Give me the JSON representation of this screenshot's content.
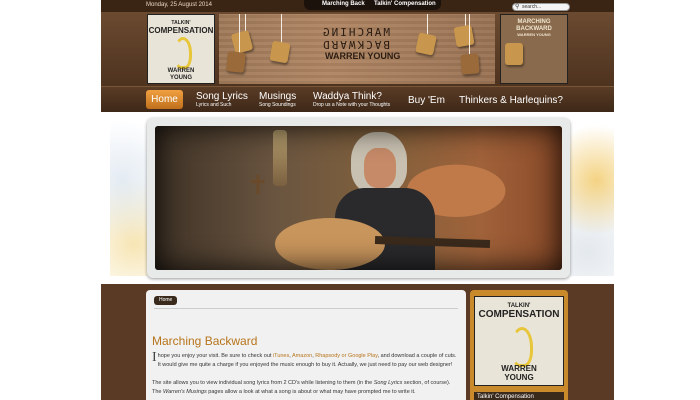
{
  "topbar": {
    "date": "Monday, 25 August 2014",
    "tabs": [
      "Marching Back",
      "Talkin' Compensation"
    ],
    "search_value": "search..."
  },
  "header": {
    "album_left": {
      "title1": "TALKIN'",
      "title2": "COMPENSATION",
      "artist1": "WARREN",
      "artist2": "YOUNG"
    },
    "banner": {
      "line1": "MARCHING",
      "line2": "BACKWARD",
      "artist": "WARREN YOUNG"
    },
    "album_right": {
      "title1": "MARCHING",
      "title2": "BACKWARD",
      "artist": "WARREN YOUNG"
    }
  },
  "nav": {
    "items": [
      {
        "label": "Home",
        "sub": ""
      },
      {
        "label": "Song Lyrics",
        "sub": "Lyrics and Such"
      },
      {
        "label": "Musings",
        "sub": "Song Soundings"
      },
      {
        "label": "Waddya Think?",
        "sub": "Drop us a Note with your Thoughts"
      },
      {
        "label": "Buy 'Em",
        "sub": ""
      },
      {
        "label": "Thinkers & Harlequins?",
        "sub": ""
      }
    ]
  },
  "breadcrumb": "Home",
  "post": {
    "title": "Marching Backward",
    "dropcap": "I",
    "p1_a": " hope you enjoy your visit.  Be sure to check out  ",
    "link_itunes": "iTunes",
    "sep1": ", ",
    "link_amazon": "Amazon",
    "sep2": ", ",
    "link_rhapsody": "Rhapsody or Google Play",
    "p1_b": ", and download a couple of cuts.  It would give me quite a charge if you enjoyed the music enough to buy it.  Actually, we just need to pay our web designer!",
    "p2_a": "The site allows you to view individual song lyrics from 2 CD's while listening to them (in the ",
    "p2_em1": "Song Lyrics",
    "p2_b": " section, of course).  The ",
    "p2_em2": "Warren's Musings",
    "p2_c": " pages allow a look at what a song is about or what may have prompted me to write it."
  },
  "sidebar": {
    "album": {
      "title1": "TALKIN'",
      "title2": "COMPENSATION",
      "artist1": "WARREN",
      "artist2": "YOUNG"
    },
    "widget_title": "Talkin' Compensation"
  },
  "colors": {
    "brown_dark": "#3a2414",
    "brown": "#5a3a24",
    "accent_orange": "#b8741c",
    "home_orange": "#e08a2c",
    "sidebar_gold": "#c88a2a"
  }
}
